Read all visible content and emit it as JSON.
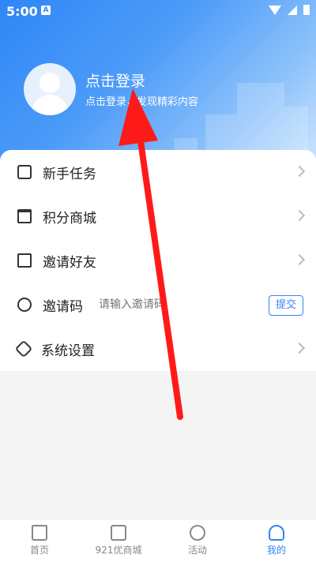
{
  "status": {
    "time": "5:00",
    "notification_glyph": "A"
  },
  "profile": {
    "title": "点击登录",
    "subtitle": "点击登录，发现精彩内容"
  },
  "menu": {
    "items": [
      {
        "label": "新手任务",
        "icon": "clipboard-check-icon"
      },
      {
        "label": "积分商城",
        "icon": "store-icon"
      },
      {
        "label": "邀请好友",
        "icon": "envelope-icon"
      }
    ],
    "invite": {
      "label": "邀请码",
      "placeholder": "请输入邀请码",
      "submit": "提交",
      "icon": "key-icon"
    },
    "settings": {
      "label": "系统设置",
      "icon": "gear-icon"
    }
  },
  "bottom_nav": [
    {
      "label": "首页",
      "icon": "home-icon",
      "active": false
    },
    {
      "label": "921优商城",
      "icon": "gift-icon",
      "active": false
    },
    {
      "label": "活动",
      "icon": "atom-icon",
      "active": false
    },
    {
      "label": "我的",
      "icon": "person-icon",
      "active": true
    }
  ],
  "colors": {
    "accent": "#2f86f6",
    "annotation_arrow": "#ff1a1a"
  }
}
